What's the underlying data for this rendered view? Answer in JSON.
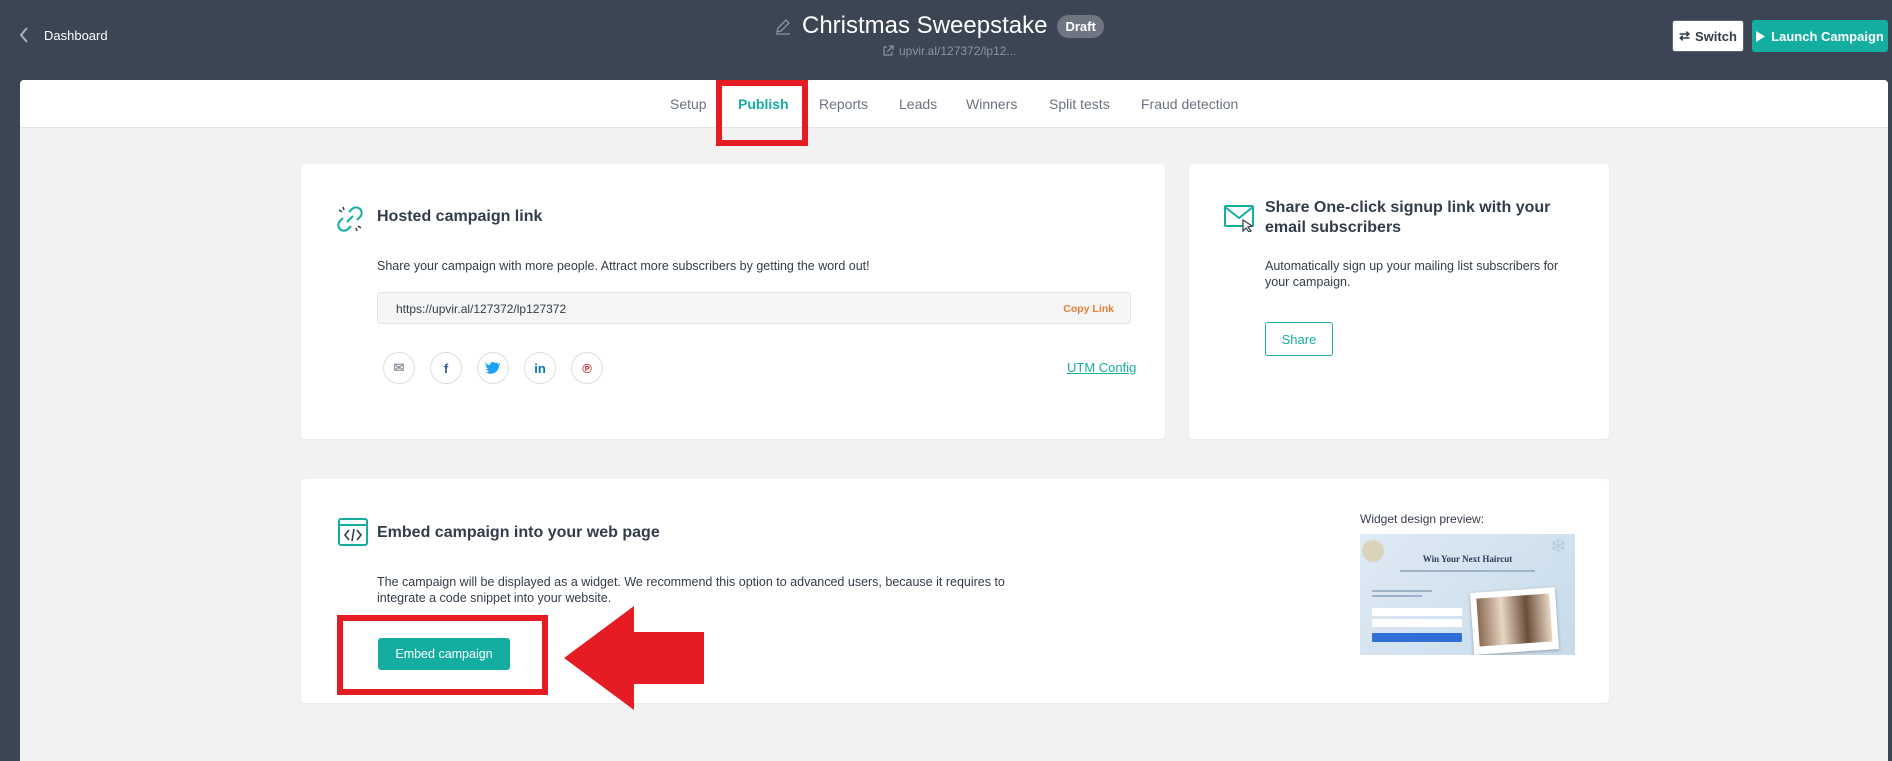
{
  "header": {
    "back_label": "Dashboard",
    "title": "Christmas Sweepstake",
    "status_badge": "Draft",
    "short_link": "upvir.al/127372/lp12...",
    "switch_label": "Switch",
    "launch_label": "Launch Campaign"
  },
  "tabs": [
    {
      "label": "Setup"
    },
    {
      "label": "Publish",
      "active": true
    },
    {
      "label": "Reports"
    },
    {
      "label": "Leads"
    },
    {
      "label": "Winners"
    },
    {
      "label": "Split tests"
    },
    {
      "label": "Fraud detection"
    }
  ],
  "hosted": {
    "title": "Hosted campaign link",
    "description": "Share your campaign with more people. Attract more subscribers by getting the word out!",
    "url": "https://upvir.al/127372/lp127372",
    "copy_label": "Copy Link",
    "utm_label": "UTM Config",
    "social_icons": [
      "email-icon",
      "facebook-icon",
      "twitter-icon",
      "linkedin-icon",
      "pinterest-icon"
    ]
  },
  "share": {
    "title": "Share One-click signup link with your email subscribers",
    "description": "Automatically sign up your mailing list subscribers for your campaign.",
    "button_label": "Share"
  },
  "embed": {
    "title": "Embed campaign into your web page",
    "description": "The campaign will be displayed as a widget. We recommend this option to advanced users, because it requires to integrate a code snippet into your website.",
    "button_label": "Embed campaign",
    "preview_label": "Widget design preview:",
    "preview_heading": "Win Your Next Haircut"
  },
  "colors": {
    "accent": "#14aea0",
    "header_bg": "#3b4553",
    "highlight": "#e51c23",
    "copy_link": "#e5803b"
  }
}
